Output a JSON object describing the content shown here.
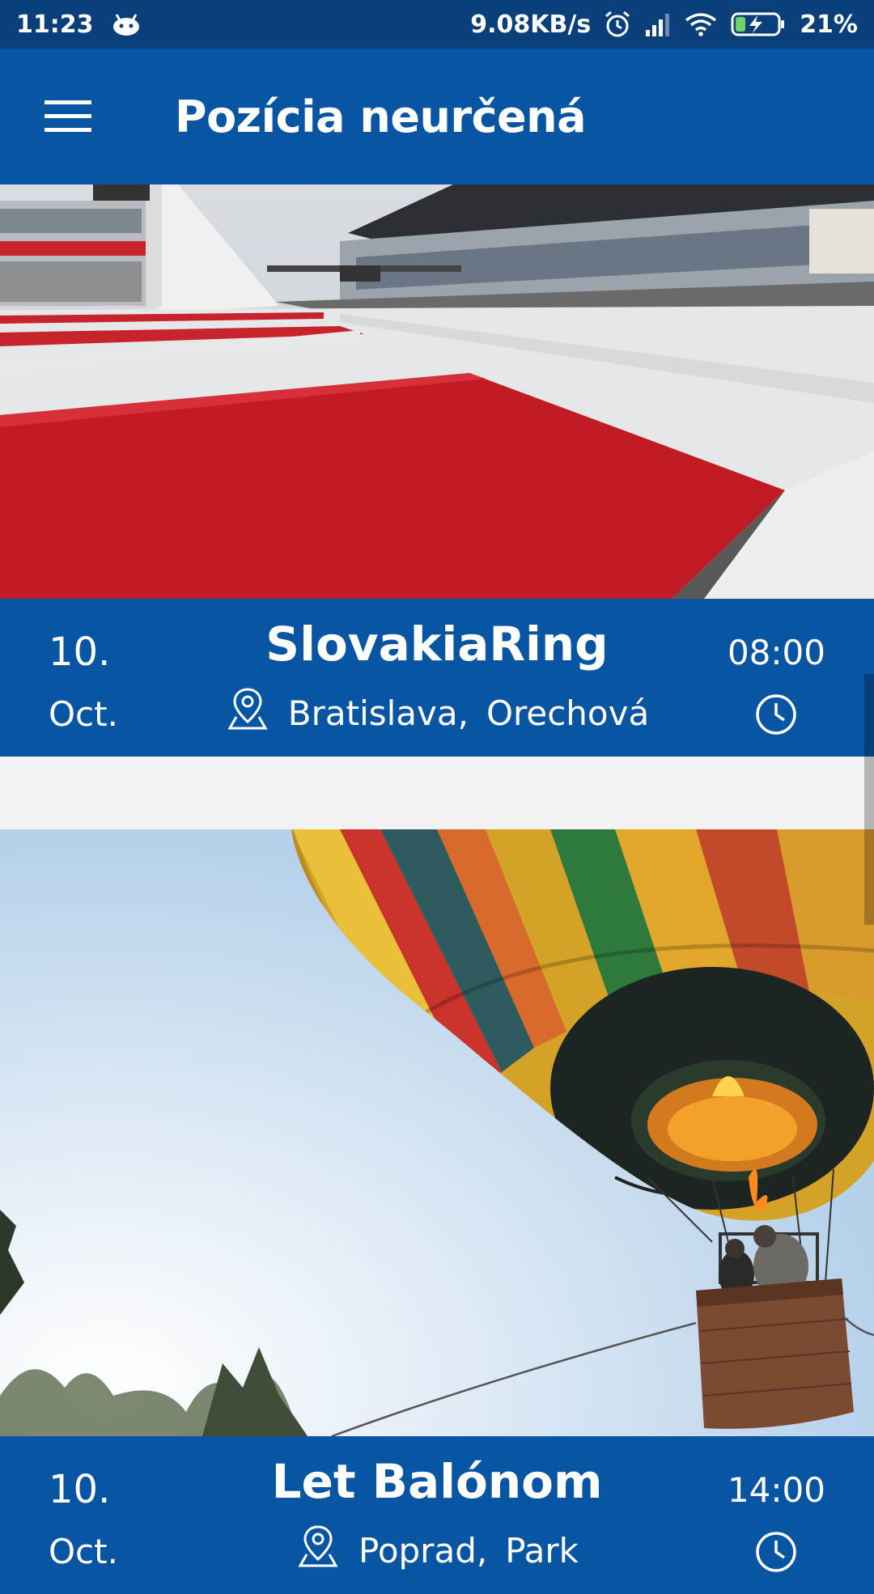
{
  "status_bar": {
    "time": "11:23",
    "net_speed": "9.08KB/s",
    "battery": "21%",
    "icons": [
      "android-icon",
      "alarm-icon",
      "signal-icon",
      "wifi-icon",
      "battery-charging-icon"
    ]
  },
  "app_bar": {
    "title": "Pozícia neurčená",
    "menu_icon": "hamburger-menu-icon"
  },
  "events": [
    {
      "day": "10.",
      "month": "Oct.",
      "name": "SlovakiaRing",
      "city": "Bratislava,",
      "place": "Orechová",
      "time": "08:00",
      "image": "race-track-photo"
    },
    {
      "day": "10.",
      "month": "Oct.",
      "name": "Let Balónom",
      "city": "Poprad,",
      "place": "Park",
      "time": "14:00",
      "image": "hot-air-balloon-photo"
    }
  ],
  "colors": {
    "status_bar": "#0a3f7a",
    "primary": "#0855a3",
    "background": "#f2f2f2"
  }
}
